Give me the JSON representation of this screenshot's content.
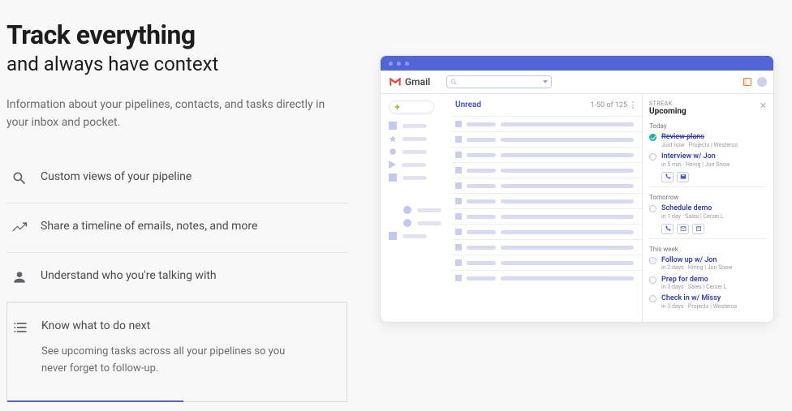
{
  "heading": "Track everything",
  "subheading": "and always have context",
  "lead": "Information about your pipelines, contacts, and tasks directly in your inbox and pocket.",
  "features": [
    {
      "title": "Custom views of your pipeline"
    },
    {
      "title": "Share a timeline of emails, notes, and more"
    },
    {
      "title": "Understand who you're talking with"
    },
    {
      "title": "Know what to do next",
      "desc": "See upcoming tasks across all your pipelines so you never forget to follow-up."
    }
  ],
  "gmail": {
    "brand": "Gmail",
    "inbox_label": "Unread",
    "inbox_count": "1-50 of 125"
  },
  "streak": {
    "brand": "STREAK",
    "panel_title": "Upcoming",
    "sections": {
      "today": "Today",
      "tomorrow": "Tomorrow",
      "thisweek": "This week"
    },
    "tasks": {
      "t1": {
        "title": "Review plans",
        "meta": "Just now · Projects | Westeros"
      },
      "t2": {
        "title": "Interview w/ Jon",
        "meta": "in 5 min · Hiring | Jon Snow"
      },
      "t3": {
        "title": "Schedule demo",
        "meta": "in 1 day · Sales | Cersei L"
      },
      "t4": {
        "title": "Follow up w/ Jon",
        "meta": "in 2 days · Hiring | Jon Snow"
      },
      "t5": {
        "title": "Prep for demo",
        "meta": "in 3 days · Sales | Cersei L"
      },
      "t6": {
        "title": "Check in w/ Missy",
        "meta": "in 3 days · Projects | Westeros"
      }
    }
  }
}
